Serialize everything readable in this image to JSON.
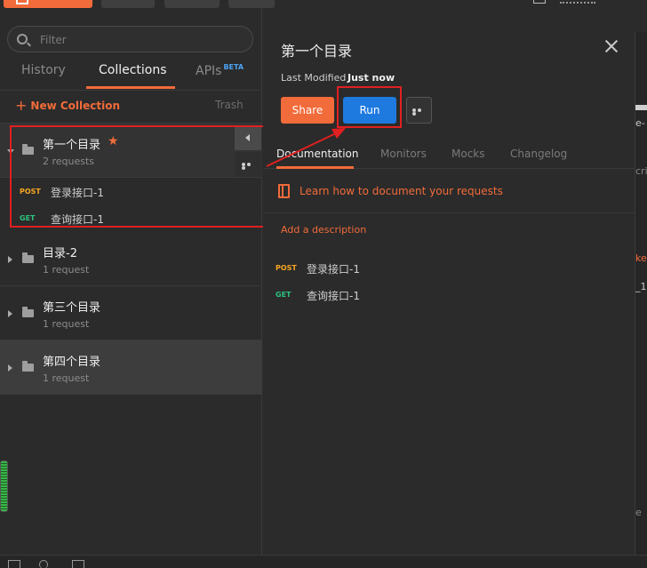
{
  "sidebar": {
    "filter_placeholder": "Filter",
    "tabs": [
      {
        "label": "History"
      },
      {
        "label": "Collections",
        "active": true
      },
      {
        "label": "APIs",
        "badge": "BETA"
      }
    ],
    "new_collection_label": "New Collection",
    "trash_label": "Trash",
    "collections": [
      {
        "name": "第一个目录",
        "count": "2 requests",
        "starred": true,
        "expanded": true,
        "requests": [
          {
            "method": "POST",
            "name": "登录接口-1"
          },
          {
            "method": "GET",
            "name": "查询接口-1"
          }
        ]
      },
      {
        "name": "目录-2",
        "count": "1 request"
      },
      {
        "name": "第三个目录",
        "count": "1 request"
      },
      {
        "name": "第四个目录",
        "count": "1 request"
      }
    ]
  },
  "panel": {
    "title": "第一个目录",
    "last_modified_label": "Last Modified",
    "last_modified_value": "Just now",
    "share_label": "Share",
    "run_label": "Run",
    "tabs": [
      {
        "label": "Documentation",
        "active": true
      },
      {
        "label": "Monitors"
      },
      {
        "label": "Mocks"
      },
      {
        "label": "Changelog"
      }
    ],
    "learn_link": "Learn how to document your requests",
    "add_description": "Add a description",
    "requests": [
      {
        "method": "POST",
        "name": "登录接口-1"
      },
      {
        "method": "GET",
        "name": "查询接口-1"
      }
    ]
  },
  "edge_fragments": [
    "e-",
    "cri",
    "ke",
    "_1",
    "e "
  ],
  "colors": {
    "accent": "#f26b3a",
    "run_blue": "#1f7ae0",
    "post": "#f5a623",
    "get": "#2ec27e",
    "annotation_red": "#e02020"
  }
}
